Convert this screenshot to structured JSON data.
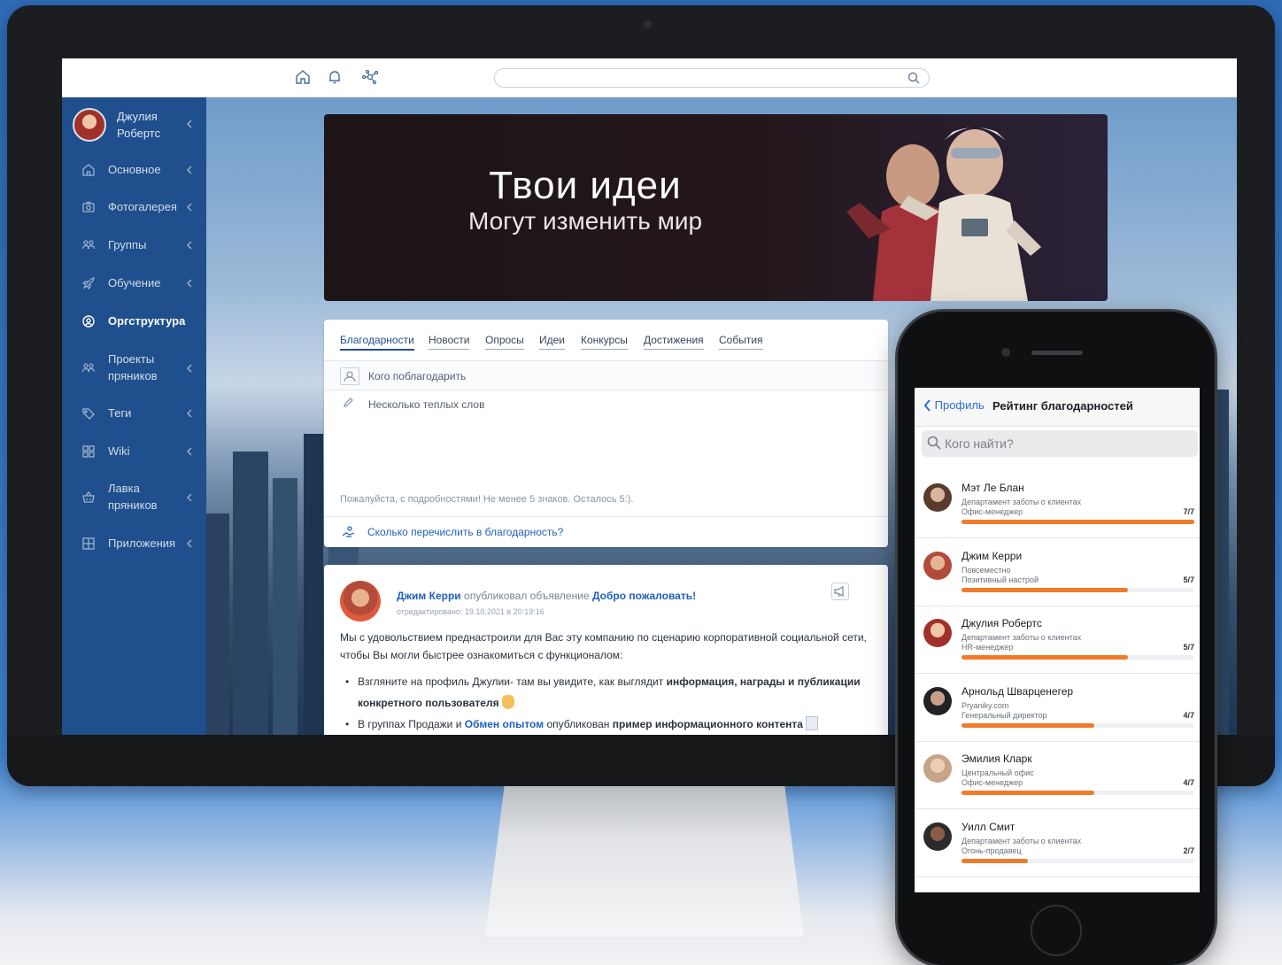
{
  "topbar": {
    "search_placeholder": "",
    "icons": [
      "home-icon",
      "bell-icon",
      "network-icon",
      "search-icon"
    ]
  },
  "sidebar": {
    "user_name": "Джулия Робертс",
    "items": [
      {
        "label": "Основное",
        "icon": "home-icon",
        "active": false,
        "chevron": true
      },
      {
        "label": "Фотогалерея",
        "icon": "camera-icon",
        "active": false,
        "chevron": true
      },
      {
        "label": "Группы",
        "icon": "users-icon",
        "active": false,
        "chevron": true
      },
      {
        "label": "Обучение",
        "icon": "rocket-icon",
        "active": false,
        "chevron": true
      },
      {
        "label": "Оргструктура",
        "icon": "user-circle-icon",
        "active": true,
        "chevron": false
      },
      {
        "label": "Проекты пряников",
        "icon": "users-icon",
        "active": false,
        "chevron": true
      },
      {
        "label": "Теги",
        "icon": "tag-icon",
        "active": false,
        "chevron": true
      },
      {
        "label": "Wiki",
        "icon": "grid-icon",
        "active": false,
        "chevron": true
      },
      {
        "label": "Лавка пряников",
        "icon": "basket-icon",
        "active": false,
        "chevron": true
      },
      {
        "label": "Приложения",
        "icon": "apps-icon",
        "active": false,
        "chevron": true
      }
    ]
  },
  "banner": {
    "title": "Твои идеи",
    "subtitle": "Могут изменить мир"
  },
  "composer": {
    "tabs": [
      "Благодарности",
      "Новости",
      "Опросы",
      "Идеи",
      "Конкурсы",
      "Достижения",
      "События"
    ],
    "active_tab": "Благодарности",
    "recipient_placeholder": "Кого поблагодарить",
    "message_placeholder": "Несколько теплых слов",
    "hint": "Пожалуйста, с подробностями! Не менее 5 знаков. Осталось 5:).",
    "transfer_link": "Сколько перечислить в благодарность?"
  },
  "post": {
    "author": "Джим Керри",
    "action": "опубликовал объявление",
    "title": "Добро пожаловать!",
    "edited": "отредактировано: 19.10.2021 в 20:19:16",
    "body": "Мы с удовольствием преднастроили для Вас эту компанию по сценарию корпоративной социальной сети, чтобы Вы могли быстрее ознакомиться с функционалом:",
    "bullet1_prefix": "Взгляните на профиль Джулии- там вы увидите, как выглядит",
    "bullet1_bold": "информация, награды и публикации конкретного пользователя",
    "bullet2_prefix": "В группах Продажи и",
    "bullet2_link": "Обмен опытом",
    "bullet2_mid": "опубликован",
    "bullet2_bold": "пример информационного контента"
  },
  "phone": {
    "back_label": "Профиль",
    "title": "Рейтинг благодарностей",
    "search_placeholder": "Кого найти?",
    "accent": "#f07c2a",
    "people": [
      {
        "name": "Мэт Ле Блан",
        "line1": "Департамент заботы о клиентах",
        "line2": "Офис-менеджер",
        "score": "7/7",
        "value": 7,
        "max": 7
      },
      {
        "name": "Джим Керри",
        "line1": "Повсеместно",
        "line2": "Позитивный настрой",
        "score": "5/7",
        "value": 5,
        "max": 7
      },
      {
        "name": "Джулия Робертс",
        "line1": "Департамент заботы о клиентах",
        "line2": "HR-менеджер",
        "score": "5/7",
        "value": 5,
        "max": 7
      },
      {
        "name": "Арнольд Шварценегер",
        "line1": "Pryaniky.com",
        "line2": "Генеральный директор",
        "score": "4/7",
        "value": 4,
        "max": 7
      },
      {
        "name": "Эмилия Кларк",
        "line1": "Центральный офис",
        "line2": "Офис-менеджер",
        "score": "4/7",
        "value": 4,
        "max": 7
      },
      {
        "name": "Уилл Смит",
        "line1": "Департамент заботы о клиентах",
        "line2": "Огонь-продавец",
        "score": "2/7",
        "value": 2,
        "max": 7
      }
    ]
  }
}
